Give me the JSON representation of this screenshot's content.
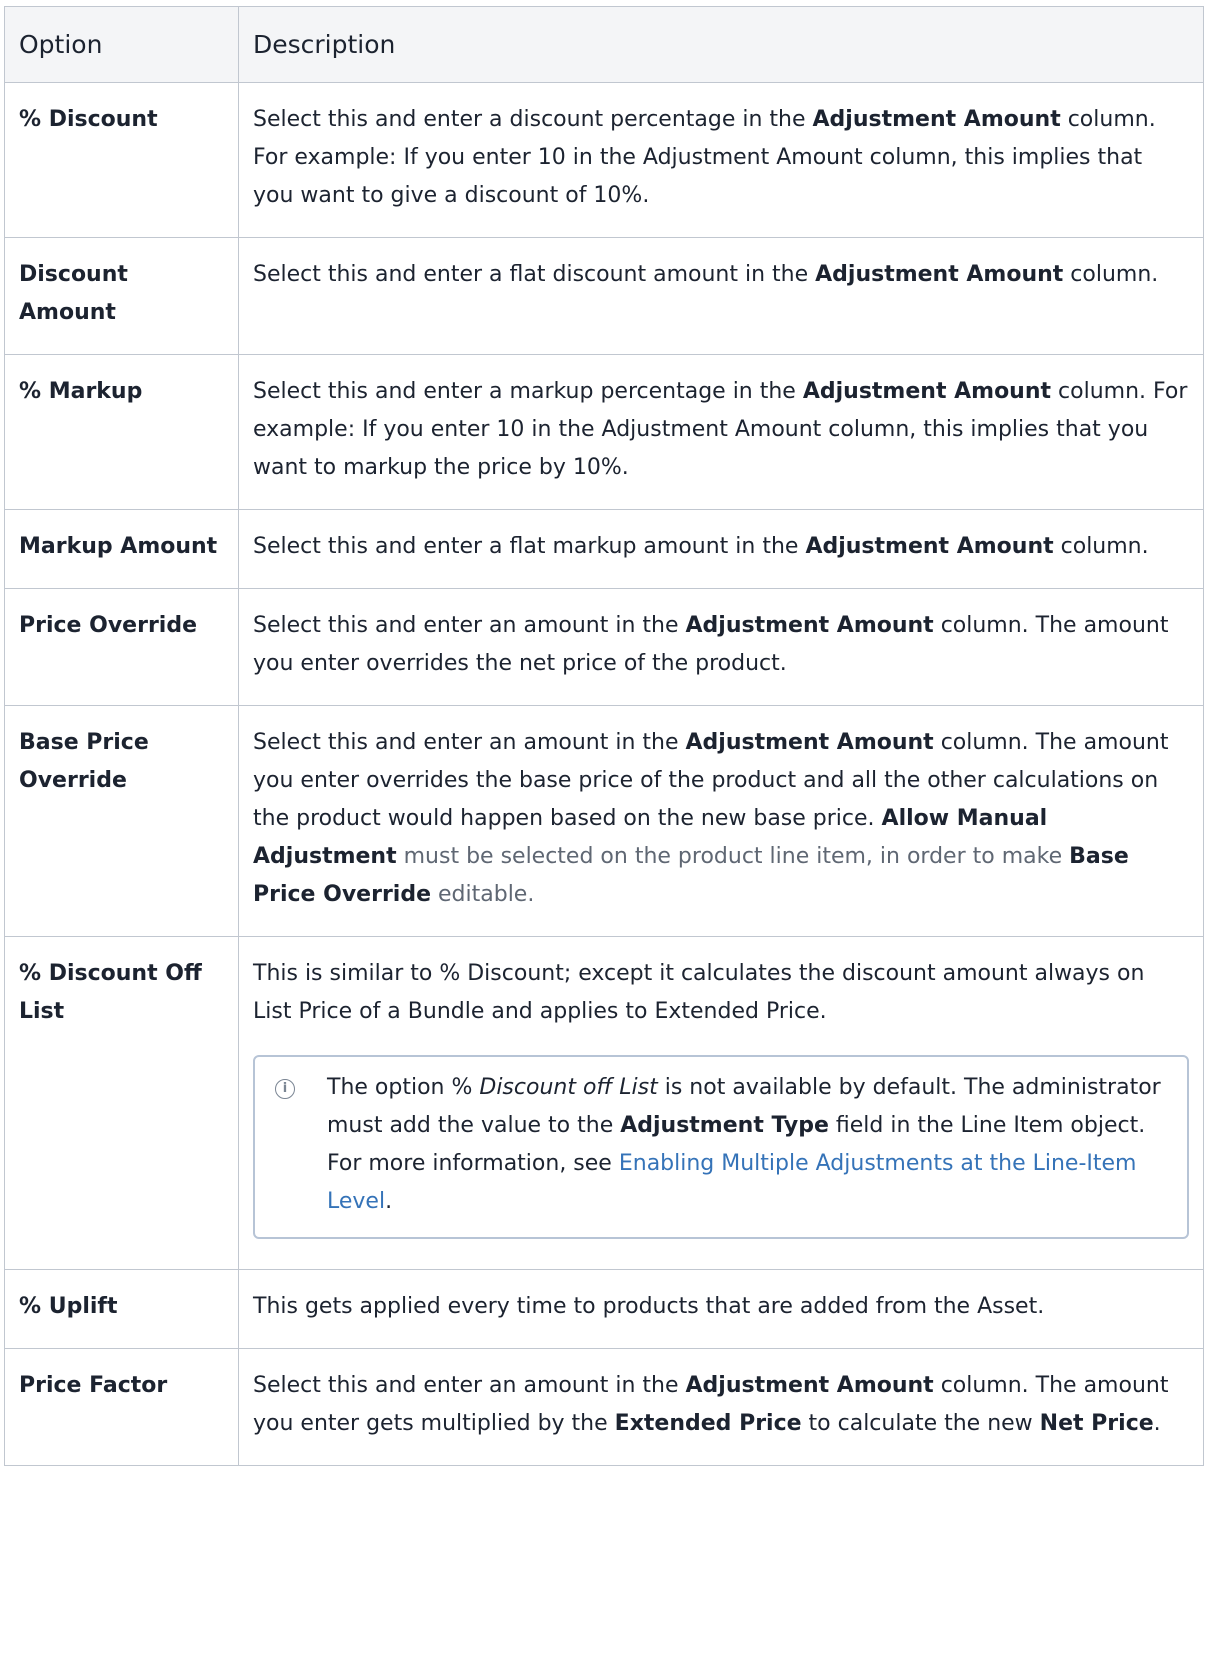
{
  "table": {
    "headers": [
      "Option",
      "Description"
    ],
    "rows": [
      {
        "option": "% Discount",
        "desc": [
          {
            "t": "Select this and enter a discount percentage in the "
          },
          {
            "t": "Adjustment Amount",
            "b": true
          },
          {
            "t": " column. For example: If you enter 10 in the Adjustment Amount column, this implies that you want to give a discount of 10%."
          }
        ]
      },
      {
        "option": "Discount Amount",
        "desc": [
          {
            "t": "Select this and enter a flat discount amount in the "
          },
          {
            "t": "Adjustment Amount",
            "b": true
          },
          {
            "t": " column."
          }
        ]
      },
      {
        "option": "% Markup",
        "desc": [
          {
            "t": "Select this and enter a markup percentage in the "
          },
          {
            "t": "Adjustment Amount",
            "b": true
          },
          {
            "t": " column. For example: If you enter 10 in the Adjustment Amount column, this implies that you want to markup the price by 10%."
          }
        ]
      },
      {
        "option": "Markup Amount",
        "desc": [
          {
            "t": "Select this and enter a flat markup amount in the "
          },
          {
            "t": "Adjustment Amount",
            "b": true
          },
          {
            "t": " column."
          }
        ]
      },
      {
        "option": "Price Override",
        "desc": [
          {
            "t": "Select this and enter an amount in the "
          },
          {
            "t": "Adjustment Amount",
            "b": true
          },
          {
            "t": " column. The amount you enter overrides the net price of the product."
          }
        ]
      },
      {
        "option": "Base Price Override",
        "desc": [
          {
            "t": "Select this and enter an amount in the "
          },
          {
            "t": "Adjustment Amount",
            "b": true
          },
          {
            "t": " column. The amount you enter overrides the base price of the product and all the other calculations on the product would happen based on the new base price. "
          },
          {
            "t": "Allow Manual Adjustment",
            "b": true
          },
          {
            "t": " must be selected on the product line item, in order to make ",
            "muted": true
          },
          {
            "t": "Base Price Override",
            "b": true
          },
          {
            "t": " editable.",
            "muted": true
          }
        ]
      },
      {
        "option": "% Discount Off List",
        "desc": [
          {
            "t": "This is similar to % Discount; except it calculates the discount amount always on List Price of a Bundle and applies to Extended Price."
          }
        ],
        "note": [
          {
            "t": "The option % "
          },
          {
            "t": "Discount off List",
            "i": true
          },
          {
            "t": " is not available by default. The administrator must add the value to the "
          },
          {
            "t": "Adjustment Type",
            "b": true
          },
          {
            "t": " field in the Line Item object. For more information, see "
          },
          {
            "t": "Enabling Multiple Adjustments at the Line-Item Level",
            "link": true
          },
          {
            "t": "."
          }
        ]
      },
      {
        "option": "% Uplift",
        "desc": [
          {
            "t": "This gets applied every time to products that are added from the Asset."
          }
        ]
      },
      {
        "option": "Price Factor",
        "desc": [
          {
            "t": "Select this and enter an amount in the "
          },
          {
            "t": "Adjustment Amount",
            "b": true
          },
          {
            "t": " column. The amount you enter gets multiplied by the "
          },
          {
            "t": "Extended Price",
            "b": true
          },
          {
            "t": " to calculate the new "
          },
          {
            "t": "Net Price",
            "b": true
          },
          {
            "t": "."
          }
        ]
      }
    ]
  },
  "icons": {
    "note_icon": "info-icon"
  },
  "colors": {
    "link": "#3573b8",
    "header_bg": "#f4f5f7",
    "border": "#c1c7d0"
  }
}
